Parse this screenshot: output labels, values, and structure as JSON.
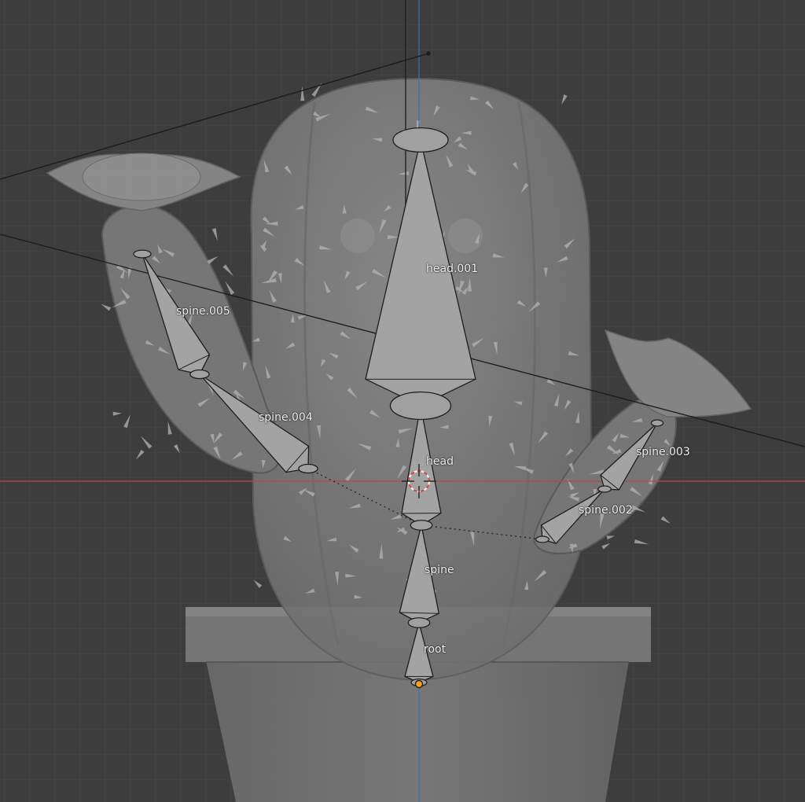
{
  "viewport": {
    "background": "#3d3d3d",
    "grid_color": "#4a4a4a",
    "x_axis_color": "#b84545",
    "y_axis_color": "#3f6fb0",
    "mesh_color": "#8a8a8a"
  },
  "bones": [
    {
      "id": "root",
      "label": "root"
    },
    {
      "id": "spine",
      "label": "spine"
    },
    {
      "id": "head",
      "label": "head"
    },
    {
      "id": "head-001",
      "label": "head.001"
    },
    {
      "id": "spine-002",
      "label": "spine.002"
    },
    {
      "id": "spine-003",
      "label": "spine.003"
    },
    {
      "id": "spine-004",
      "label": "spine.004"
    },
    {
      "id": "spine-005",
      "label": "spine.005"
    }
  ],
  "icons": [
    "3d-cursor-icon",
    "origin-dot-icon"
  ]
}
